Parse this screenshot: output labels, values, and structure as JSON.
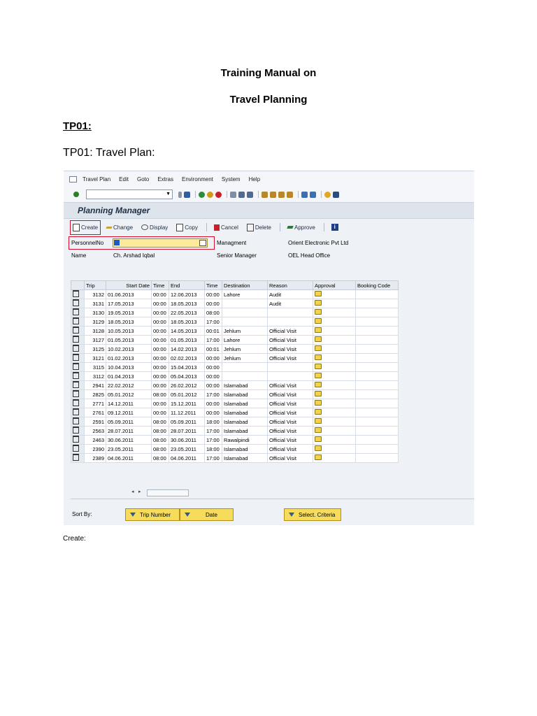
{
  "document": {
    "title_line1": "Training Manual on",
    "title_line2": "Travel Planning",
    "section_heading": "TP01:",
    "section_subheading": "TP01: Travel Plan:",
    "footer_note": "Create:"
  },
  "sap": {
    "menu": [
      "Travel Plan",
      "Edit",
      "Goto",
      "Extras",
      "Environment",
      "System",
      "Help"
    ],
    "screen_title": "Planning Manager",
    "app_toolbar": {
      "create": "Create",
      "change": "Change",
      "display": "Display",
      "copy": "Copy",
      "cancel": "Cancel",
      "delete": "Delete",
      "approve": "Approve"
    },
    "fields": {
      "personnel_label": "PersonnelNo",
      "personnel_value": "",
      "name_label": "Name",
      "name_value": "Ch. Arshad Iqbal",
      "org_unit": "Managment",
      "position": "Senior Manager",
      "company": "Orient Electronic Pvt Ltd",
      "office": "OEL Head Office"
    },
    "table": {
      "columns": [
        "Trip",
        "Start Date",
        "Time",
        "End",
        "Time",
        "Destination",
        "Reason",
        "Approval",
        "Booking Code"
      ],
      "rows": [
        {
          "trip": "3132",
          "start": "01.06.2013",
          "t1": "00:00",
          "end": "12.06.2013",
          "t2": "00:00",
          "dest": "Lahore",
          "reason": "Audit"
        },
        {
          "trip": "3131",
          "start": "17.05.2013",
          "t1": "00:00",
          "end": "18.05.2013",
          "t2": "00:00",
          "dest": "",
          "reason": "Audit"
        },
        {
          "trip": "3130",
          "start": "19.05.2013",
          "t1": "00:00",
          "end": "22.05.2013",
          "t2": "08:00",
          "dest": "",
          "reason": ""
        },
        {
          "trip": "3129",
          "start": "18.05.2013",
          "t1": "00:00",
          "end": "18.05.2013",
          "t2": "17:00",
          "dest": "",
          "reason": ""
        },
        {
          "trip": "3128",
          "start": "10.05.2013",
          "t1": "00:00",
          "end": "14.05.2013",
          "t2": "00:01",
          "dest": "Jehlum",
          "reason": "Official Visit"
        },
        {
          "trip": "3127",
          "start": "01.05.2013",
          "t1": "00:00",
          "end": "01.05.2013",
          "t2": "17:00",
          "dest": "Lahore",
          "reason": "Official Visit"
        },
        {
          "trip": "3125",
          "start": "10.02.2013",
          "t1": "00:00",
          "end": "14.02.2013",
          "t2": "00:01",
          "dest": "Jehlum",
          "reason": "Official Visit"
        },
        {
          "trip": "3121",
          "start": "01.02.2013",
          "t1": "00:00",
          "end": "02.02.2013",
          "t2": "00:00",
          "dest": "Jehlum",
          "reason": "Official Visit"
        },
        {
          "trip": "3115",
          "start": "10.04.2013",
          "t1": "00:00",
          "end": "15.04.2013",
          "t2": "00:00",
          "dest": "",
          "reason": ""
        },
        {
          "trip": "3112",
          "start": "01.04.2013",
          "t1": "00:00",
          "end": "05.04.2013",
          "t2": "00:00",
          "dest": "",
          "reason": ""
        },
        {
          "trip": "2941",
          "start": "22.02.2012",
          "t1": "00:00",
          "end": "26.02.2012",
          "t2": "00:00",
          "dest": "Islamabad",
          "reason": "Official Visit"
        },
        {
          "trip": "2825",
          "start": "05.01.2012",
          "t1": "08:00",
          "end": "05.01.2012",
          "t2": "17:00",
          "dest": "Islamabad",
          "reason": "Official Visit"
        },
        {
          "trip": "2771",
          "start": "14.12.2011",
          "t1": "00:00",
          "end": "15.12.2011",
          "t2": "00:00",
          "dest": "Islamabad",
          "reason": "Official Visit"
        },
        {
          "trip": "2761",
          "start": "09.12.2011",
          "t1": "00:00",
          "end": "11.12.2011",
          "t2": "00:00",
          "dest": "Islamabad",
          "reason": "Official Visit"
        },
        {
          "trip": "2591",
          "start": "05.09.2011",
          "t1": "08:00",
          "end": "05.09.2011",
          "t2": "18:00",
          "dest": "Islamabad",
          "reason": "Official Visit"
        },
        {
          "trip": "2563",
          "start": "28.07.2011",
          "t1": "08:00",
          "end": "28.07.2011",
          "t2": "17:00",
          "dest": "Islamabad",
          "reason": "Official Visit"
        },
        {
          "trip": "2463",
          "start": "30.06.2011",
          "t1": "08:00",
          "end": "30.06.2011",
          "t2": "17:00",
          "dest": "Rawalpindi",
          "reason": "Official Visit"
        },
        {
          "trip": "2390",
          "start": "23.05.2011",
          "t1": "08:00",
          "end": "23.05.2011",
          "t2": "18:00",
          "dest": "Islamabad",
          "reason": "Official Visit"
        },
        {
          "trip": "2389",
          "start": "04.06.2011",
          "t1": "08:00",
          "end": "04.06.2011",
          "t2": "17:00",
          "dest": "Islamabad",
          "reason": "Official Visit"
        }
      ]
    },
    "sort": {
      "label": "Sort By:",
      "trip_number": "Trip Number",
      "date": "Date",
      "select_criteria": "Select. Criteria"
    }
  }
}
